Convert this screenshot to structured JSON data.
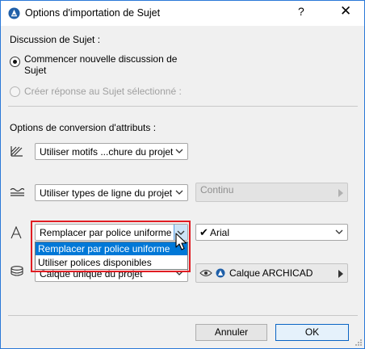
{
  "window": {
    "title": "Options d'importation de Sujet",
    "help": "?",
    "close": "✕"
  },
  "discussion": {
    "heading": "Discussion de Sujet :",
    "option1_line1": "Commencer nouvelle discussion de",
    "option1_line2": "Sujet",
    "option2": "Créer réponse au Sujet sélectionné :",
    "selected": "option1"
  },
  "conversion": {
    "heading": "Options de conversion d'attributs :",
    "hatch_select": "Utiliser motifs ...chure du projet",
    "line_select": "Utiliser types de ligne du projet",
    "line_sub": "Continu",
    "font_select": "Remplacer par police uniforme",
    "font_sub_check": "✔",
    "font_sub": "Arial",
    "layer_select": "Calque unique du projet",
    "layer_sub": "Calque ARCHICAD"
  },
  "font_dropdown": {
    "options": [
      "Remplacer par police uniforme",
      "Utiliser polices disponibles"
    ],
    "selected_index": 0
  },
  "buttons": {
    "cancel": "Annuler",
    "ok": "OK"
  },
  "colors": {
    "accent": "#0078d7",
    "highlight": "#e11d23",
    "border": "#2b79d8"
  }
}
